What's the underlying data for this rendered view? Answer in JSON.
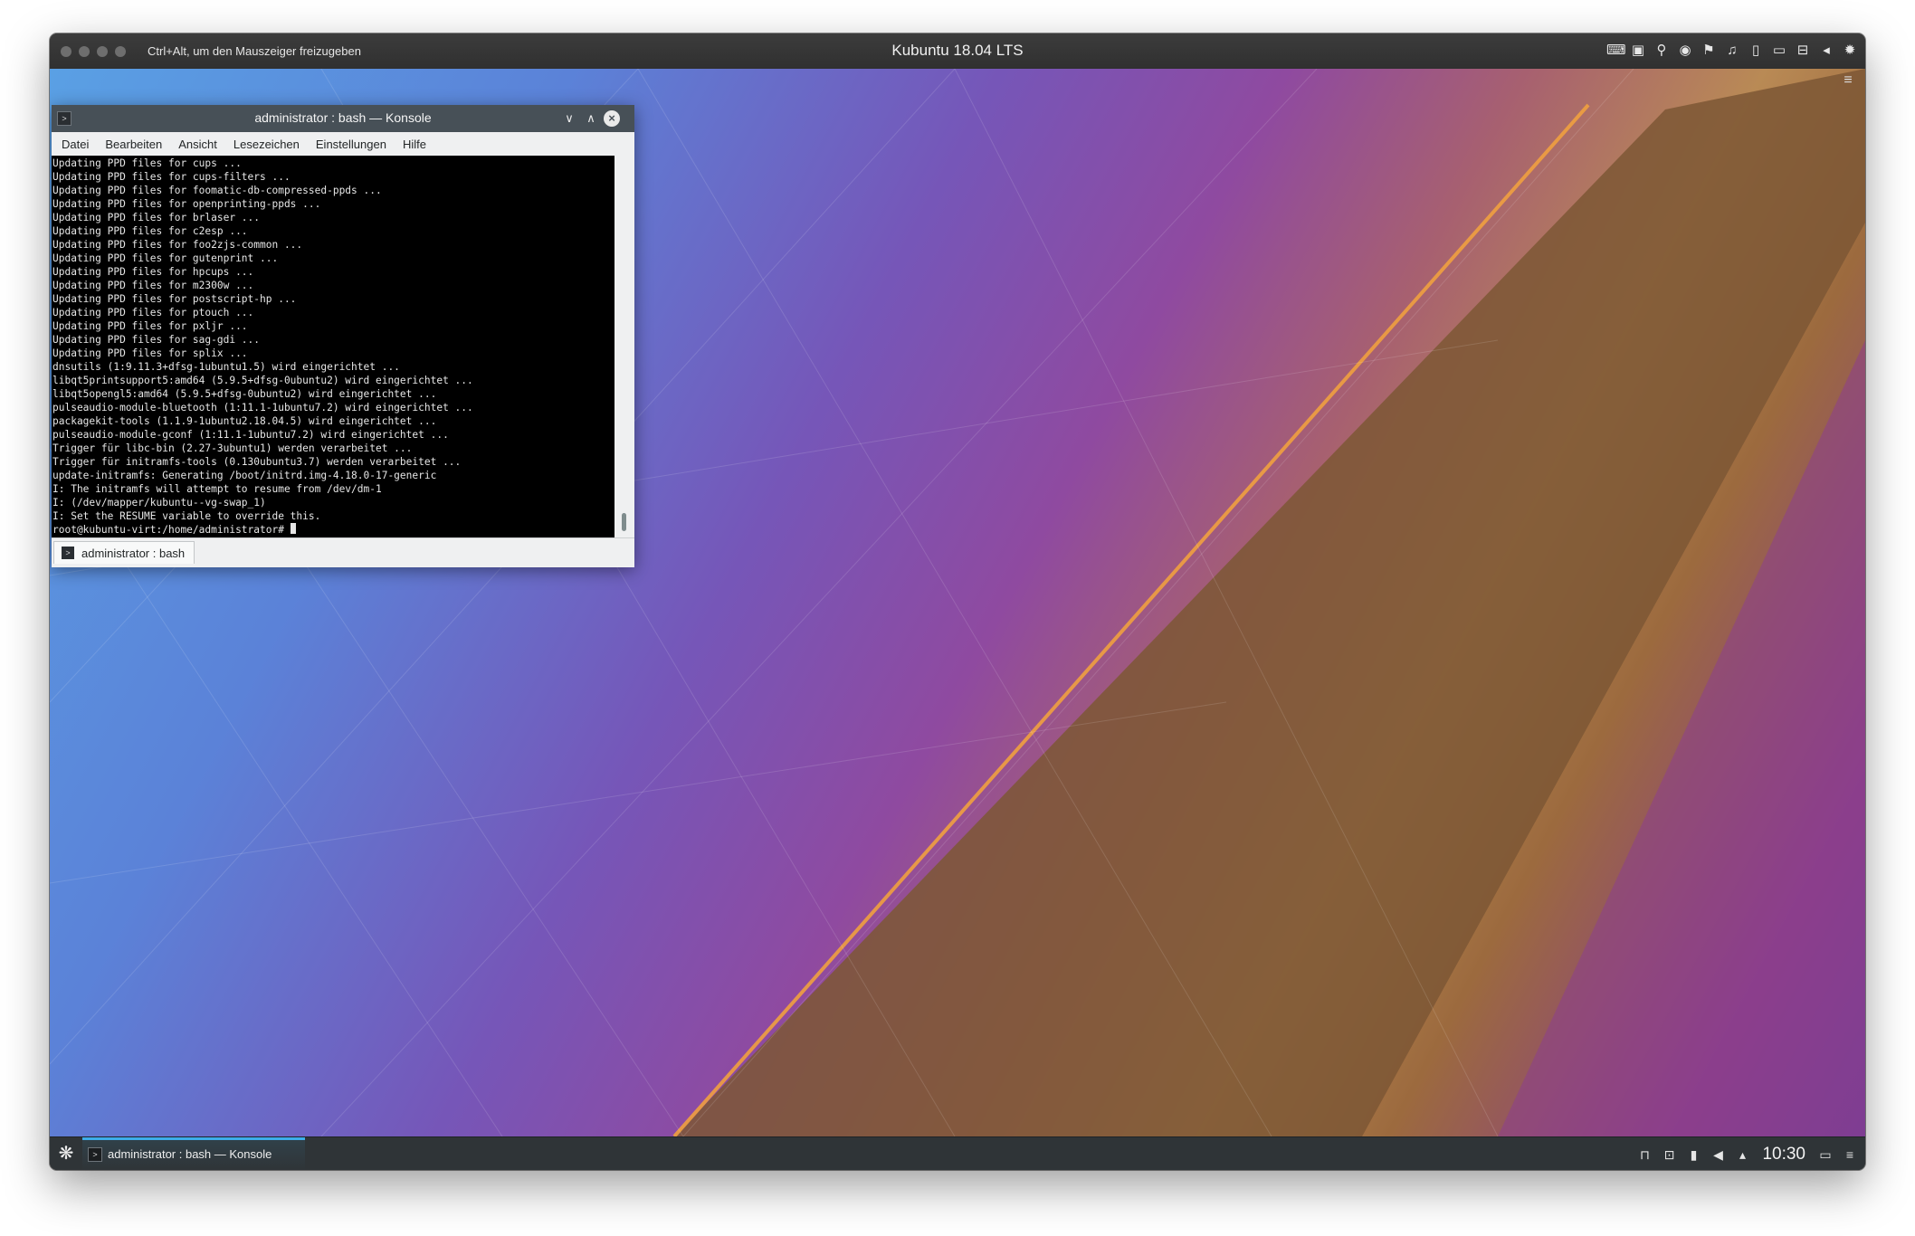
{
  "host_window": {
    "hint": "Ctrl+Alt, um den Mauszeiger freizugeben",
    "title": "Kubuntu 18.04 LTS",
    "toolbar_icons": [
      "keyboard-icon",
      "cpu-icon",
      "usb-icon",
      "disc-icon",
      "network-icon",
      "audio-icon",
      "tablet-icon",
      "camera-icon",
      "shared-folder-icon",
      "back-icon",
      "settings-icon"
    ]
  },
  "konsole": {
    "title": "administrator : bash — Konsole",
    "menu": [
      "Datei",
      "Bearbeiten",
      "Ansicht",
      "Lesezeichen",
      "Einstellungen",
      "Hilfe"
    ],
    "terminal_lines": [
      "Updating PPD files for cups ...",
      "Updating PPD files for cups-filters ...",
      "Updating PPD files for foomatic-db-compressed-ppds ...",
      "Updating PPD files for openprinting-ppds ...",
      "Updating PPD files for brlaser ...",
      "Updating PPD files for c2esp ...",
      "Updating PPD files for foo2zjs-common ...",
      "Updating PPD files for gutenprint ...",
      "Updating PPD files for hpcups ...",
      "Updating PPD files for m2300w ...",
      "Updating PPD files for postscript-hp ...",
      "Updating PPD files for ptouch ...",
      "Updating PPD files for pxljr ...",
      "Updating PPD files for sag-gdi ...",
      "Updating PPD files for splix ...",
      "dnsutils (1:9.11.3+dfsg-1ubuntu1.5) wird eingerichtet ...",
      "libqt5printsupport5:amd64 (5.9.5+dfsg-0ubuntu2) wird eingerichtet ...",
      "libqt5opengl5:amd64 (5.9.5+dfsg-0ubuntu2) wird eingerichtet ...",
      "pulseaudio-module-bluetooth (1:11.1-1ubuntu7.2) wird eingerichtet ...",
      "packagekit-tools (1.1.9-1ubuntu2.18.04.5) wird eingerichtet ...",
      "pulseaudio-module-gconf (1:11.1-1ubuntu7.2) wird eingerichtet ...",
      "Trigger für libc-bin (2.27-3ubuntu1) werden verarbeitet ...",
      "Trigger für initramfs-tools (0.130ubuntu3.7) werden verarbeitet ...",
      "update-initramfs: Generating /boot/initrd.img-4.18.0-17-generic",
      "I: The initramfs will attempt to resume from /dev/dm-1",
      "I: (/dev/mapper/kubuntu--vg-swap_1)",
      "I: Set the RESUME variable to override this."
    ],
    "prompt": "root@kubuntu-virt:/home/administrator# ",
    "tab_label": "administrator : bash"
  },
  "panel": {
    "task_label": "administrator : bash — Konsole",
    "clock": "10:30",
    "tray_icons": [
      "usb-device-icon",
      "display-icon",
      "lock-icon",
      "volume-icon",
      "expand-tray-icon"
    ],
    "accent_color": "#3daee9"
  }
}
